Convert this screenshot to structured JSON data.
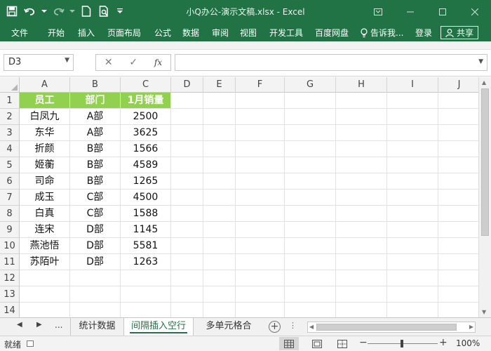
{
  "window": {
    "title": "小Q办公-演示文稿.xlsx - Excel"
  },
  "menu": {
    "items": [
      "文件",
      "开始",
      "插入",
      "页面布局",
      "公式",
      "数据",
      "审阅",
      "视图",
      "开发工具",
      "百度网盘"
    ],
    "tell_me": "告诉我...",
    "login": "登录",
    "share": "共享"
  },
  "formula_bar": {
    "name_box": "D3",
    "cancel": "✕",
    "enter": "✓",
    "fx": "fx",
    "formula": ""
  },
  "columns": [
    "A",
    "B",
    "C",
    "D",
    "E",
    "F",
    "G",
    "H",
    "I",
    "J"
  ],
  "rows": [
    "1",
    "2",
    "3",
    "4",
    "5",
    "6",
    "7",
    "8",
    "9",
    "10",
    "11",
    "12",
    "13",
    "14"
  ],
  "table": {
    "headers": [
      "员工",
      "部门",
      "1月销量"
    ],
    "data": [
      [
        "白凤九",
        "A部",
        "2500"
      ],
      [
        "东华",
        "A部",
        "3625"
      ],
      [
        "折颜",
        "B部",
        "1566"
      ],
      [
        "姬蘅",
        "B部",
        "4589"
      ],
      [
        "司命",
        "B部",
        "1265"
      ],
      [
        "成玉",
        "C部",
        "4500"
      ],
      [
        "白真",
        "C部",
        "1588"
      ],
      [
        "连宋",
        "D部",
        "1145"
      ],
      [
        "燕池悟",
        "D部",
        "5581"
      ],
      [
        "苏陌叶",
        "D部",
        "1263"
      ]
    ]
  },
  "sheets": {
    "more": "...",
    "tabs": [
      "统计数据",
      "间隔插入空行",
      "多单元格合"
    ],
    "active_index": 1
  },
  "status": {
    "ready": "就绪",
    "zoom": "100%"
  },
  "colors": {
    "excel_green": "#217346",
    "header_fill": "#92d050"
  }
}
